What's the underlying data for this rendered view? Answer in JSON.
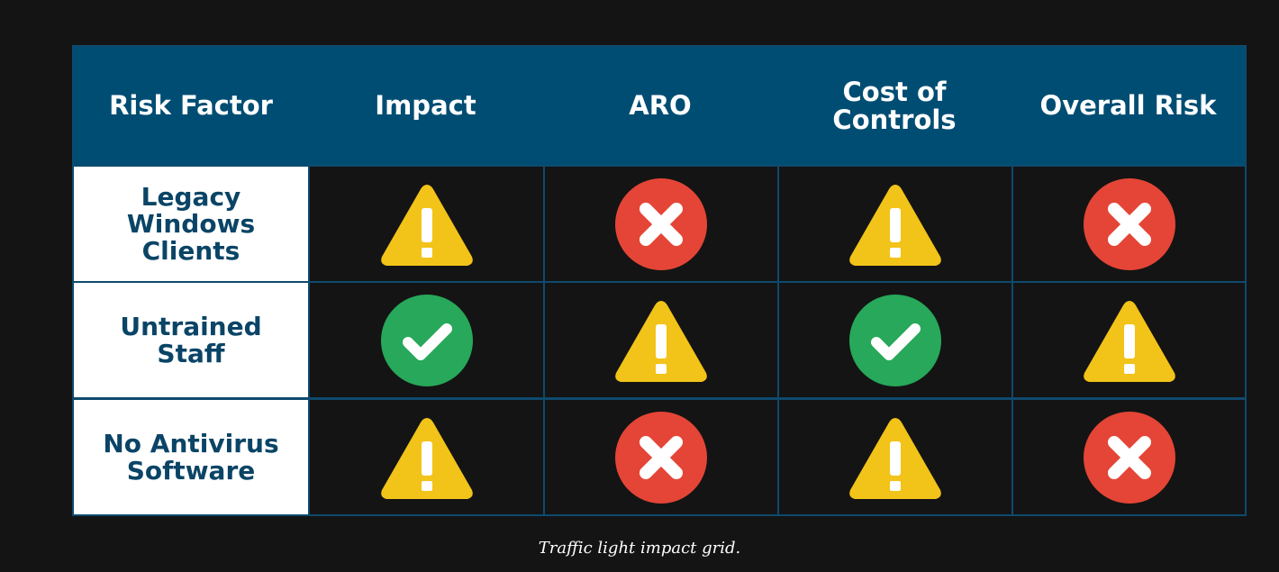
{
  "colors": {
    "header_bg": "#004d73",
    "label_text": "#0a4466",
    "warning": "#f2c318",
    "fail": "#e44536",
    "pass": "#27a85a",
    "background": "#141414"
  },
  "grid": {
    "headers": [
      "Risk Factor",
      "Impact",
      "ARO",
      "Cost of\nControls",
      "Overall Risk"
    ],
    "rows": [
      {
        "label": "Legacy\nWindows\nClients",
        "statuses": [
          "warning-icon",
          "fail-icon",
          "warning-icon",
          "fail-icon"
        ]
      },
      {
        "label": "Untrained\nStaff",
        "statuses": [
          "pass-icon",
          "warning-icon",
          "pass-icon",
          "warning-icon"
        ]
      },
      {
        "label": "No Antivirus\nSoftware",
        "statuses": [
          "warning-icon",
          "fail-icon",
          "warning-icon",
          "fail-icon"
        ]
      }
    ]
  },
  "caption": "Traffic light impact grid."
}
